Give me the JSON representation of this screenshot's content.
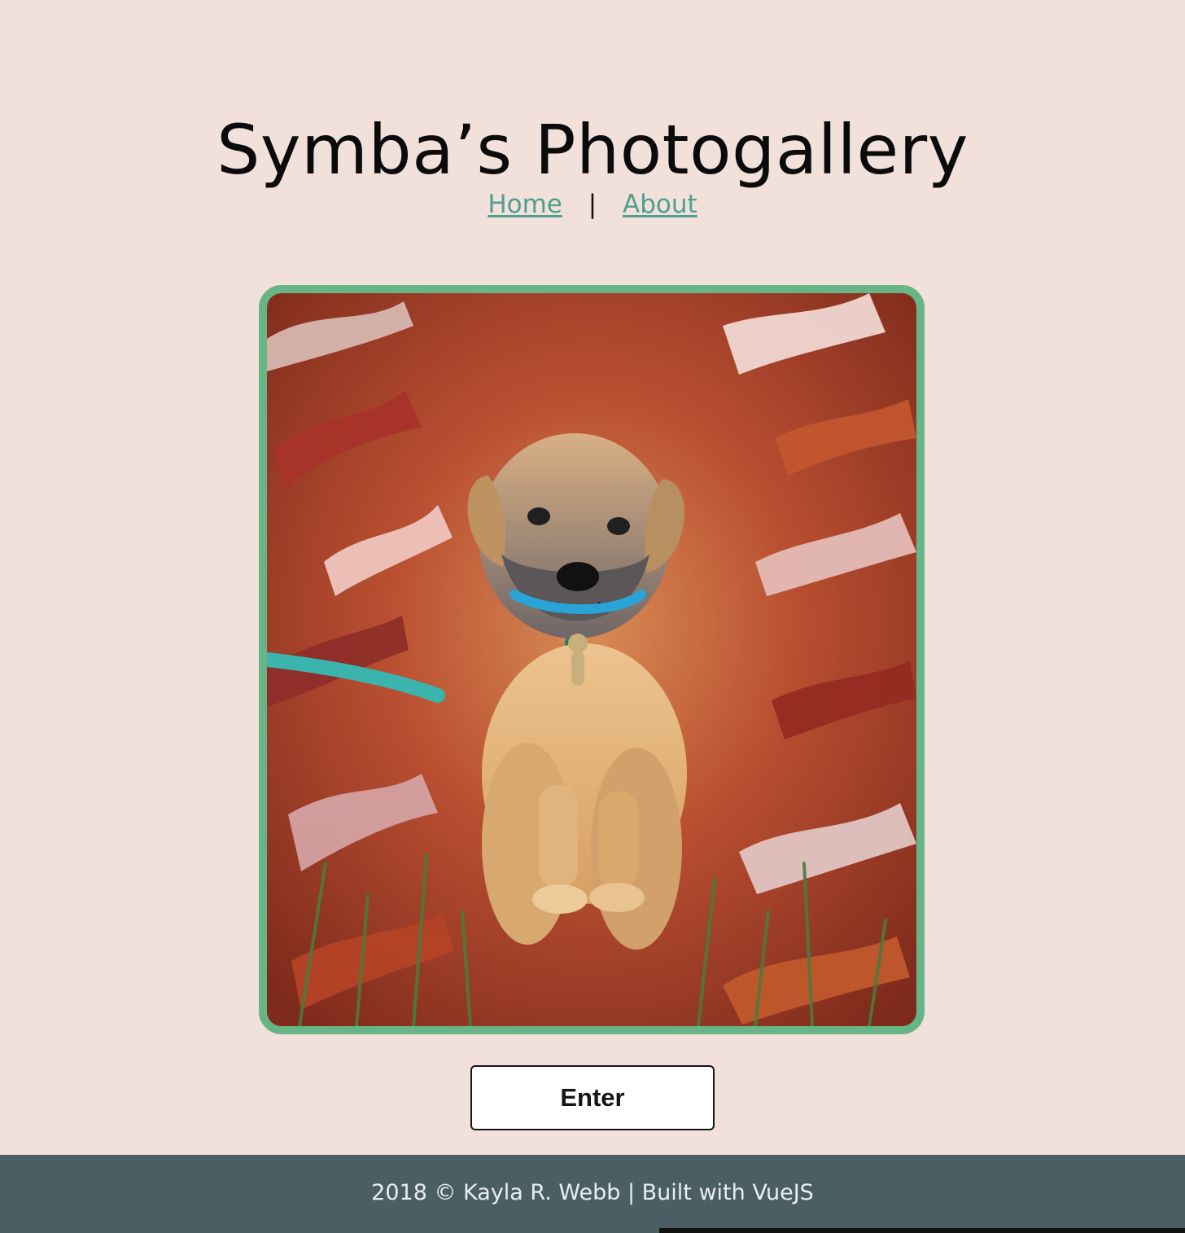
{
  "header": {
    "title": "Symba’s Photogallery"
  },
  "navigation": {
    "items": [
      {
        "label": "Home"
      },
      {
        "label": "About"
      }
    ],
    "separator": "|"
  },
  "gallery": {
    "frame_color": "#67b487",
    "image": {
      "subject": "puppy in autumn leaves"
    }
  },
  "actions": {
    "enter_label": "Enter"
  },
  "footer": {
    "text": "2018 © Kayla R. Webb | Built with VueJS"
  },
  "colors": {
    "page_background": "#f2e1db",
    "link": "#4f9f8e",
    "footer_background": "#4b5e64"
  }
}
